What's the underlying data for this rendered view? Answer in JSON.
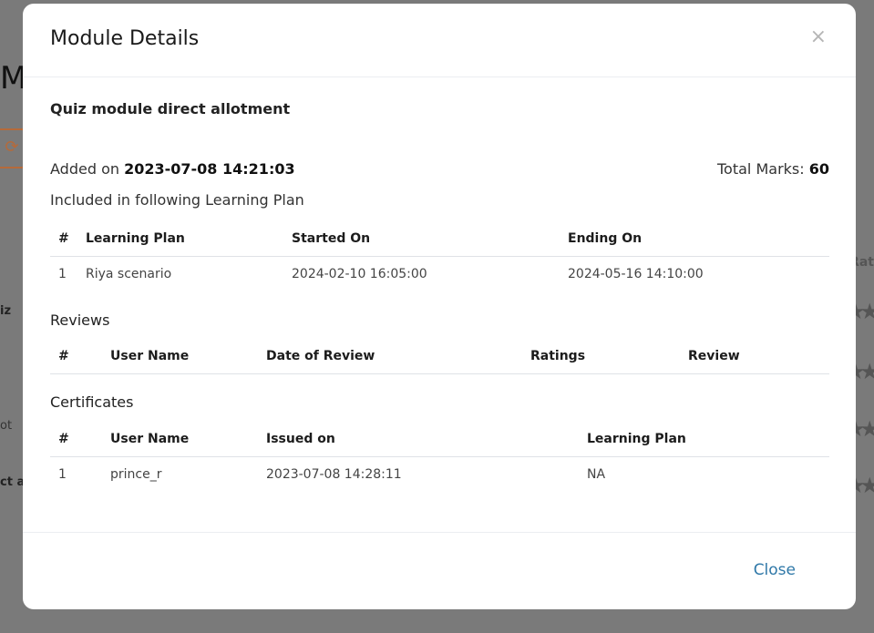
{
  "background": {
    "heading_char": "M",
    "refresh_icon": "refresh-icon",
    "side_labels": [
      "iz",
      "ot",
      "ct a"
    ],
    "ratings_fragment": "Rat"
  },
  "modal": {
    "title": "Module Details",
    "close_icon": "×",
    "module_name": "Quiz module direct allotment",
    "added_prefix": "Added on",
    "added_date": "2023-07-08 14:21:03",
    "total_prefix": "Total Marks:",
    "total_marks": "60",
    "included_text": "Included in following Learning Plan",
    "learning_plans": {
      "headers": [
        "#",
        "Learning Plan",
        "Started On",
        "Ending On"
      ],
      "rows": [
        [
          "1",
          "Riya scenario",
          "2024-02-10 16:05:00",
          "2024-05-16 14:10:00"
        ]
      ]
    },
    "reviews": {
      "title": "Reviews",
      "headers": [
        "#",
        "User Name",
        "Date of Review",
        "Ratings",
        "Review"
      ],
      "rows": []
    },
    "certificates": {
      "title": "Certificates",
      "headers": [
        "#",
        "User Name",
        "Issued on",
        "Learning Plan"
      ],
      "rows": [
        [
          "1",
          "prince_r",
          "2023-07-08 14:28:11",
          "NA"
        ]
      ]
    },
    "footer": {
      "close_label": "Close"
    }
  }
}
